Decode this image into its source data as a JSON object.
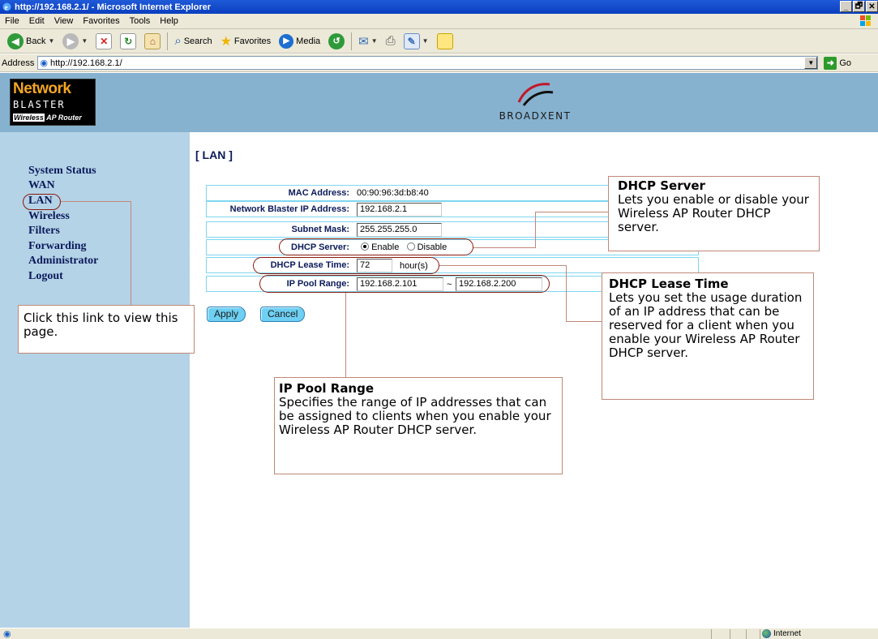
{
  "window": {
    "title": "http://192.168.2.1/ - Microsoft Internet Explorer",
    "buttons": [
      "_",
      "🗗",
      "✕"
    ]
  },
  "menubar": [
    "File",
    "Edit",
    "View",
    "Favorites",
    "Tools",
    "Help"
  ],
  "toolbar": {
    "back": "Back",
    "search": "Search",
    "favorites": "Favorites",
    "media": "Media"
  },
  "address": {
    "label": "Address",
    "url": "http://192.168.2.1/",
    "go": "Go"
  },
  "header": {
    "logo_line1": "Network",
    "logo_line2": "BLASTER",
    "logo_wireless": "Wireless",
    "logo_ap": "AP Router",
    "brand": "BROADXENT"
  },
  "nav": [
    "System Status",
    "WAN",
    "LAN",
    "Wireless",
    "Filters",
    "Forwarding",
    "Administrator",
    "Logout"
  ],
  "page": {
    "title": "[ LAN ]"
  },
  "form": {
    "mac_label": "MAC Address:",
    "mac_value": "00:90:96:3d:b8:40",
    "ip_label": "Network Blaster IP Address:",
    "ip_value": "192.168.2.1",
    "mask_label": "Subnet Mask:",
    "mask_value": "255.255.255.0",
    "dhcp_label": "DHCP Server:",
    "dhcp_enable": "Enable",
    "dhcp_disable": "Disable",
    "dhcp_selected": "Enable",
    "lease_label": "DHCP Lease Time:",
    "lease_value": "72",
    "lease_unit": "hour(s)",
    "pool_label": "IP Pool Range:",
    "pool_start": "192.168.2.101",
    "pool_sep": "~",
    "pool_end": "192.168.2.200"
  },
  "buttons": {
    "apply": "Apply",
    "cancel": "Cancel"
  },
  "callouts": {
    "dhcp_server": {
      "title": "DHCP Server",
      "body": "Lets you enable or disable your Wireless AP Router DHCP server."
    },
    "lease_time": {
      "title": "DHCP Lease Time",
      "body": "Lets you set the usage duration of an IP address that can be reserved for a client when you enable your Wireless AP Router DHCP server."
    },
    "pool_range": {
      "title": "IP Pool Range",
      "body": "Specifies the range of IP addresses that can be assigned to clients when you enable your Wireless AP Router DHCP server."
    },
    "lan_link": {
      "body": "Click this link to view this page."
    }
  },
  "status": {
    "zone": "Internet"
  },
  "colors": {
    "header_bg": "#86b2cf",
    "nav_bg": "#b5d3e7",
    "callout_border": "#c08878",
    "oval": "#8a1a10",
    "button": "#6ed0f2"
  }
}
